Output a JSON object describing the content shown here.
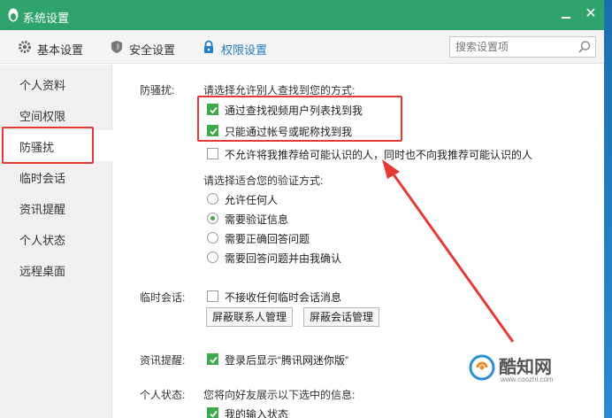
{
  "window": {
    "title": "系统设置"
  },
  "toolbar": {
    "tabs": [
      {
        "label": "基本设置"
      },
      {
        "label": "安全设置"
      },
      {
        "label": "权限设置"
      }
    ]
  },
  "search": {
    "placeholder": "搜索设置项"
  },
  "sidebar": {
    "items": [
      {
        "label": "个人资料"
      },
      {
        "label": "空间权限"
      },
      {
        "label": "防骚扰"
      },
      {
        "label": "临时会话"
      },
      {
        "label": "资讯提醒"
      },
      {
        "label": "个人状态"
      },
      {
        "label": "远程桌面"
      }
    ],
    "active_index": 2
  },
  "antiharass": {
    "section_label": "防骚扰:",
    "find_prompt": "请选择允许别人查找到您的方式:",
    "find_options": [
      {
        "label": "通过查找视频用户列表找到我",
        "checked": true
      },
      {
        "label": "只能通过帐号或昵称找到我",
        "checked": true
      },
      {
        "label": "不允许将我推荐给可能认识的人，同时也不向我推荐可能认识的人",
        "checked": false
      }
    ],
    "verify_prompt": "请选择适合您的验证方式:",
    "verify_options": [
      {
        "label": "允许任何人",
        "selected": false
      },
      {
        "label": "需要验证信息",
        "selected": true
      },
      {
        "label": "需要正确回答问题",
        "selected": false
      },
      {
        "label": "需要回答问题并由我确认",
        "selected": false
      }
    ]
  },
  "temp_session": {
    "section_label": "临时会话:",
    "option": {
      "label": "不接收任何临时会话消息",
      "checked": false
    },
    "buttons": {
      "block_contacts": "屏蔽联系人管理",
      "block_sessions": "屏蔽会话管理"
    }
  },
  "news": {
    "section_label": "资讯提醒:",
    "option": {
      "label": "登录后显示“腾讯网迷你版”",
      "checked": true
    }
  },
  "status": {
    "section_label": "个人状态:",
    "prompt": "您将向好友展示以下选中的信息:",
    "option": {
      "label": "我的输入状态",
      "checked": true
    }
  },
  "watermark": {
    "name": "酷知网",
    "url": "www.coozhi.com"
  },
  "colors": {
    "titlebar": "#2fa36b",
    "accent": "#1e7fc4",
    "check": "#3daa4c",
    "annotation": "#e53935"
  }
}
